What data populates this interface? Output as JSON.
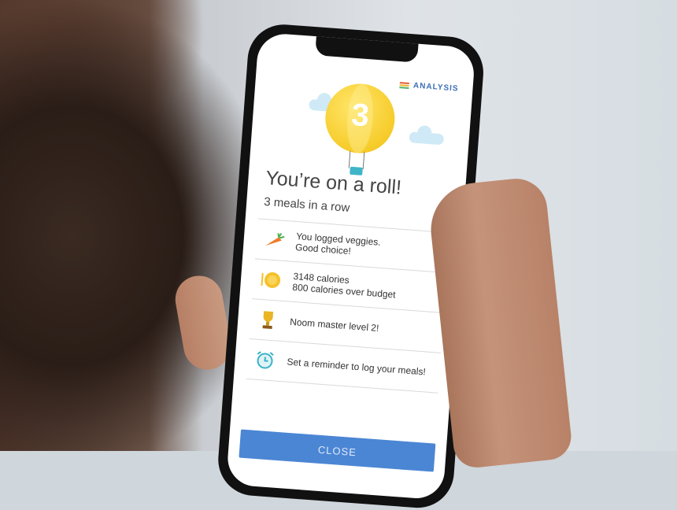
{
  "header": {
    "analysis_label": "ANALYSIS",
    "analysis_icon": "stacked-bars-icon"
  },
  "celebration": {
    "balloon_number": "3",
    "title": "You’re on a roll!",
    "subtitle": "3 meals in a row"
  },
  "items": [
    {
      "icon": "carrot-icon",
      "line1": "You logged veggies.",
      "line2": "Good choice!"
    },
    {
      "icon": "plate-icon",
      "line1": "3148 calories",
      "line2": "800 calories over budget"
    },
    {
      "icon": "trophy-icon",
      "line1": "Noom master level 2!",
      "line2": ""
    },
    {
      "icon": "alarm-clock-icon",
      "line1": "Set a reminder to log your meals!",
      "line2": ""
    }
  ],
  "footer": {
    "close_label": "CLOSE"
  },
  "colors": {
    "accent": "#4b86d4",
    "balloon": "#f6cc2a",
    "analysis": "#3b6fb5"
  }
}
